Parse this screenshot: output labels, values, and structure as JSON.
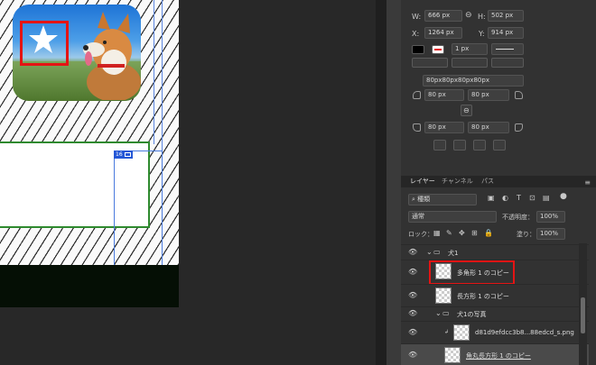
{
  "properties": {
    "w_label": "W:",
    "w_value": "666 px",
    "h_label": "H:",
    "h_value": "502 px",
    "x_label": "X:",
    "x_value": "1264 px",
    "y_label": "Y:",
    "y_value": "914 px",
    "stroke_width": "1 px",
    "radius_all": "80px80px80px80px",
    "radius_tl": "80 px",
    "radius_tr": "80 px",
    "radius_bl": "80 px",
    "radius_br": "80 px"
  },
  "layers_panel": {
    "tabs": [
      "レイヤー",
      "チャンネル",
      "パス"
    ],
    "filter_kind": "種類",
    "blend_mode": "通常",
    "opacity_label": "不透明度：",
    "opacity_value": "100%",
    "lock_label": "ロック：",
    "fill_label": "塗り：",
    "fill_value": "100%",
    "layers": [
      {
        "name": "犬1",
        "type": "group"
      },
      {
        "name": "多角形 1 のコピー",
        "type": "shape",
        "selected": true
      },
      {
        "name": "長方形 1 のコピー",
        "type": "shape"
      },
      {
        "name": "犬1の写真",
        "type": "group"
      },
      {
        "name": "d81d9efdcc3b8...88edcd_s.png",
        "type": "image"
      },
      {
        "name": "角丸長方形 1 のコピー",
        "type": "shape"
      }
    ]
  },
  "canvas": {
    "selection_label": "16"
  },
  "colors": {
    "selection_red": "#e41414",
    "guide_blue": "#5c86e0",
    "frame_green": "#2f8a2f"
  }
}
